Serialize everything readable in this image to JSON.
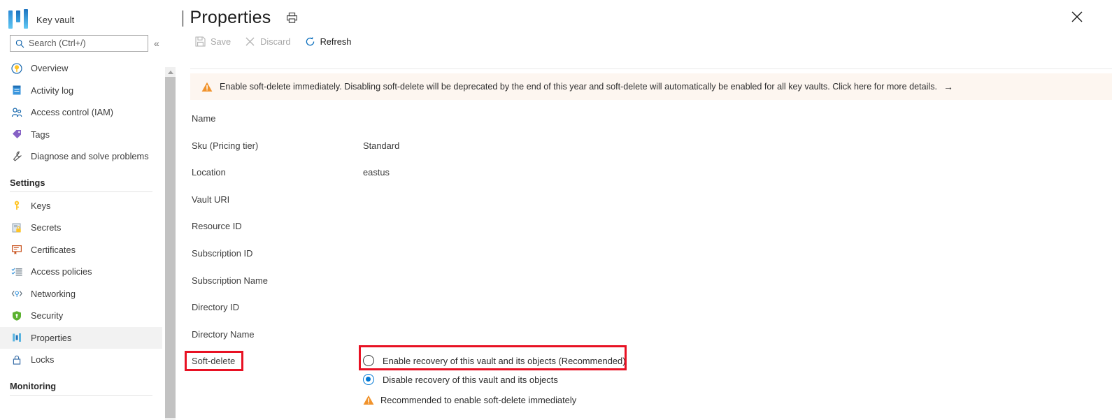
{
  "sidebar": {
    "resource_type": "Key vault",
    "logo_icon": "key-vault-icon",
    "search": {
      "placeholder": "Search (Ctrl+/)",
      "icon": "search-icon"
    },
    "collapse_icon": "double-chevron-left-icon",
    "items": [
      {
        "label": "Overview",
        "icon": "overview-icon",
        "selected": false
      },
      {
        "label": "Activity log",
        "icon": "activity-log-icon",
        "selected": false
      },
      {
        "label": "Access control (IAM)",
        "icon": "access-control-icon",
        "selected": false
      },
      {
        "label": "Tags",
        "icon": "tags-icon",
        "selected": false
      },
      {
        "label": "Diagnose and solve problems",
        "icon": "diagnose-icon",
        "selected": false
      }
    ],
    "groups": [
      {
        "title": "Settings",
        "items": [
          {
            "label": "Keys",
            "icon": "key-icon",
            "selected": false
          },
          {
            "label": "Secrets",
            "icon": "secrets-icon",
            "selected": false
          },
          {
            "label": "Certificates",
            "icon": "certificates-icon",
            "selected": false
          },
          {
            "label": "Access policies",
            "icon": "access-policies-icon",
            "selected": false
          },
          {
            "label": "Networking",
            "icon": "networking-icon",
            "selected": false
          },
          {
            "label": "Security",
            "icon": "shield-icon",
            "selected": false
          },
          {
            "label": "Properties",
            "icon": "properties-icon",
            "selected": true
          },
          {
            "label": "Locks",
            "icon": "lock-icon",
            "selected": false
          }
        ]
      },
      {
        "title": "Monitoring",
        "items": []
      }
    ]
  },
  "header": {
    "title_separator": "|",
    "title": "Properties",
    "print_icon": "print-icon",
    "close_icon": "close-icon"
  },
  "toolbar": {
    "buttons": [
      {
        "label": "Save",
        "icon": "save-icon",
        "disabled": true
      },
      {
        "label": "Discard",
        "icon": "discard-icon",
        "disabled": true
      },
      {
        "label": "Refresh",
        "icon": "refresh-icon",
        "disabled": false
      }
    ]
  },
  "banner": {
    "icon": "warning-icon",
    "text": "Enable soft-delete immediately. Disabling soft-delete will be deprecated by the end of this year and soft-delete will automatically be enabled for all key vaults. Click here for more details.",
    "arrow": "→"
  },
  "properties": [
    {
      "label": "Name",
      "value": ""
    },
    {
      "label": "Sku (Pricing tier)",
      "value": "Standard"
    },
    {
      "label": "Location",
      "value": "eastus"
    },
    {
      "label": "Vault URI",
      "value": ""
    },
    {
      "label": "Resource ID",
      "value": ""
    },
    {
      "label": "Subscription ID",
      "value": ""
    },
    {
      "label": "Subscription Name",
      "value": ""
    },
    {
      "label": "Directory ID",
      "value": ""
    },
    {
      "label": "Directory Name",
      "value": ""
    },
    {
      "label": "Soft-delete",
      "value": ""
    }
  ],
  "soft_delete": {
    "options": [
      {
        "label": "Enable recovery of this vault and its objects (Recommended)",
        "selected": false
      },
      {
        "label": "Disable recovery of this vault and its objects",
        "selected": true
      }
    ],
    "note": {
      "icon": "warning-icon",
      "text": "Recommended to enable soft-delete immediately"
    }
  },
  "highlights": {
    "accent_color": "#e81123",
    "boxes": [
      {
        "target": "soft-delete-label"
      },
      {
        "target": "enable-recovery-radio-option"
      }
    ]
  }
}
